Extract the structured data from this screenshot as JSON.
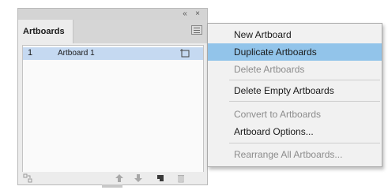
{
  "panel": {
    "title_buttons": {
      "collapse": "«",
      "close": "×"
    },
    "tab_label": "Artboards",
    "rows": [
      {
        "number": "1",
        "name": "Artboard 1"
      }
    ]
  },
  "menu": {
    "items": [
      {
        "label": "New Artboard",
        "state": "enabled"
      },
      {
        "label": "Duplicate Artboards",
        "state": "highlighted"
      },
      {
        "label": "Delete Artboards",
        "state": "disabled"
      },
      {
        "label": "Delete Empty Artboards",
        "state": "enabled"
      },
      {
        "label": "Convert to Artboards",
        "state": "disabled"
      },
      {
        "label": "Artboard Options...",
        "state": "enabled"
      },
      {
        "label": "Rearrange All Artboards...",
        "state": "disabled"
      }
    ]
  },
  "colors": {
    "highlight": "#92c4ea",
    "selected_row": "#c5d9f1",
    "disabled_text": "#8c8c8c"
  }
}
